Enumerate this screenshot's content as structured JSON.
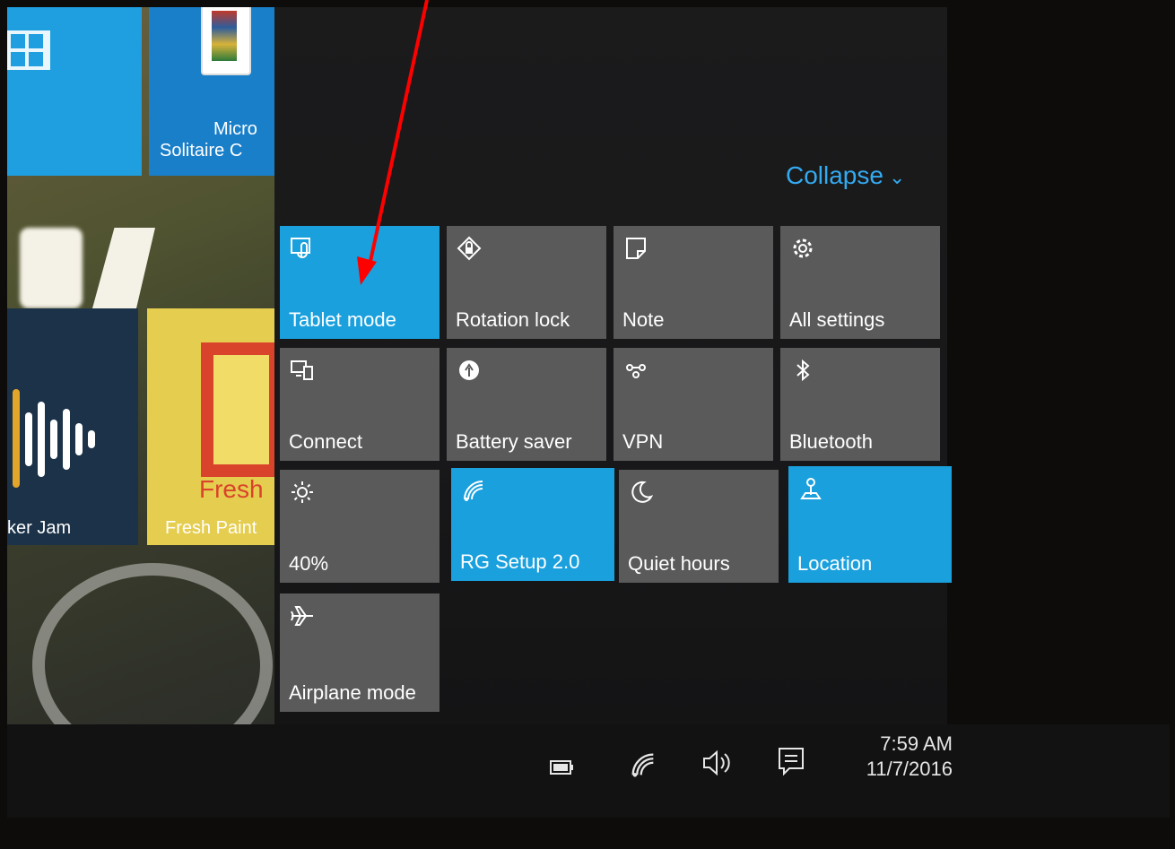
{
  "start_tiles": {
    "solitaire_label_line1": "Micro",
    "solitaire_label_line2": "Solitaire C",
    "joker_label": "ker Jam",
    "fresh_brand": "Fresh",
    "fresh_label": "Fresh Paint"
  },
  "action_center": {
    "collapse_label": "Collapse",
    "collapse_icon": "chevron-down-icon",
    "tiles": [
      {
        "label": "Tablet mode",
        "icon": "tablet-mode-icon",
        "active": true
      },
      {
        "label": "Rotation lock",
        "icon": "rotation-lock-icon",
        "active": false
      },
      {
        "label": "Note",
        "icon": "note-icon",
        "active": false
      },
      {
        "label": "All settings",
        "icon": "gear-icon",
        "active": false
      },
      {
        "label": "Connect",
        "icon": "connect-icon",
        "active": false
      },
      {
        "label": "Battery saver",
        "icon": "battery-saver-icon",
        "active": false
      },
      {
        "label": "VPN",
        "icon": "vpn-icon",
        "active": false
      },
      {
        "label": "Bluetooth",
        "icon": "bluetooth-icon",
        "active": false
      },
      {
        "label": "40%",
        "icon": "brightness-icon",
        "active": false
      },
      {
        "label": "RG Setup 2.0",
        "icon": "wifi-icon",
        "active": true
      },
      {
        "label": "Quiet hours",
        "icon": "moon-icon",
        "active": false
      },
      {
        "label": "Location",
        "icon": "location-icon",
        "active": true
      },
      {
        "label": "Airplane mode",
        "icon": "airplane-icon",
        "active": false
      }
    ],
    "active_color": "#1aa0dd",
    "inactive_color": "#5a5a5b",
    "accent_color": "#34aaf0"
  },
  "taskbar": {
    "tray_icons": [
      "battery-icon",
      "wifi-icon",
      "volume-icon",
      "notification-icon"
    ],
    "time": "7:59 AM",
    "date": "11/7/2016"
  },
  "annotation": {
    "arrow_color": "#ff0000"
  }
}
